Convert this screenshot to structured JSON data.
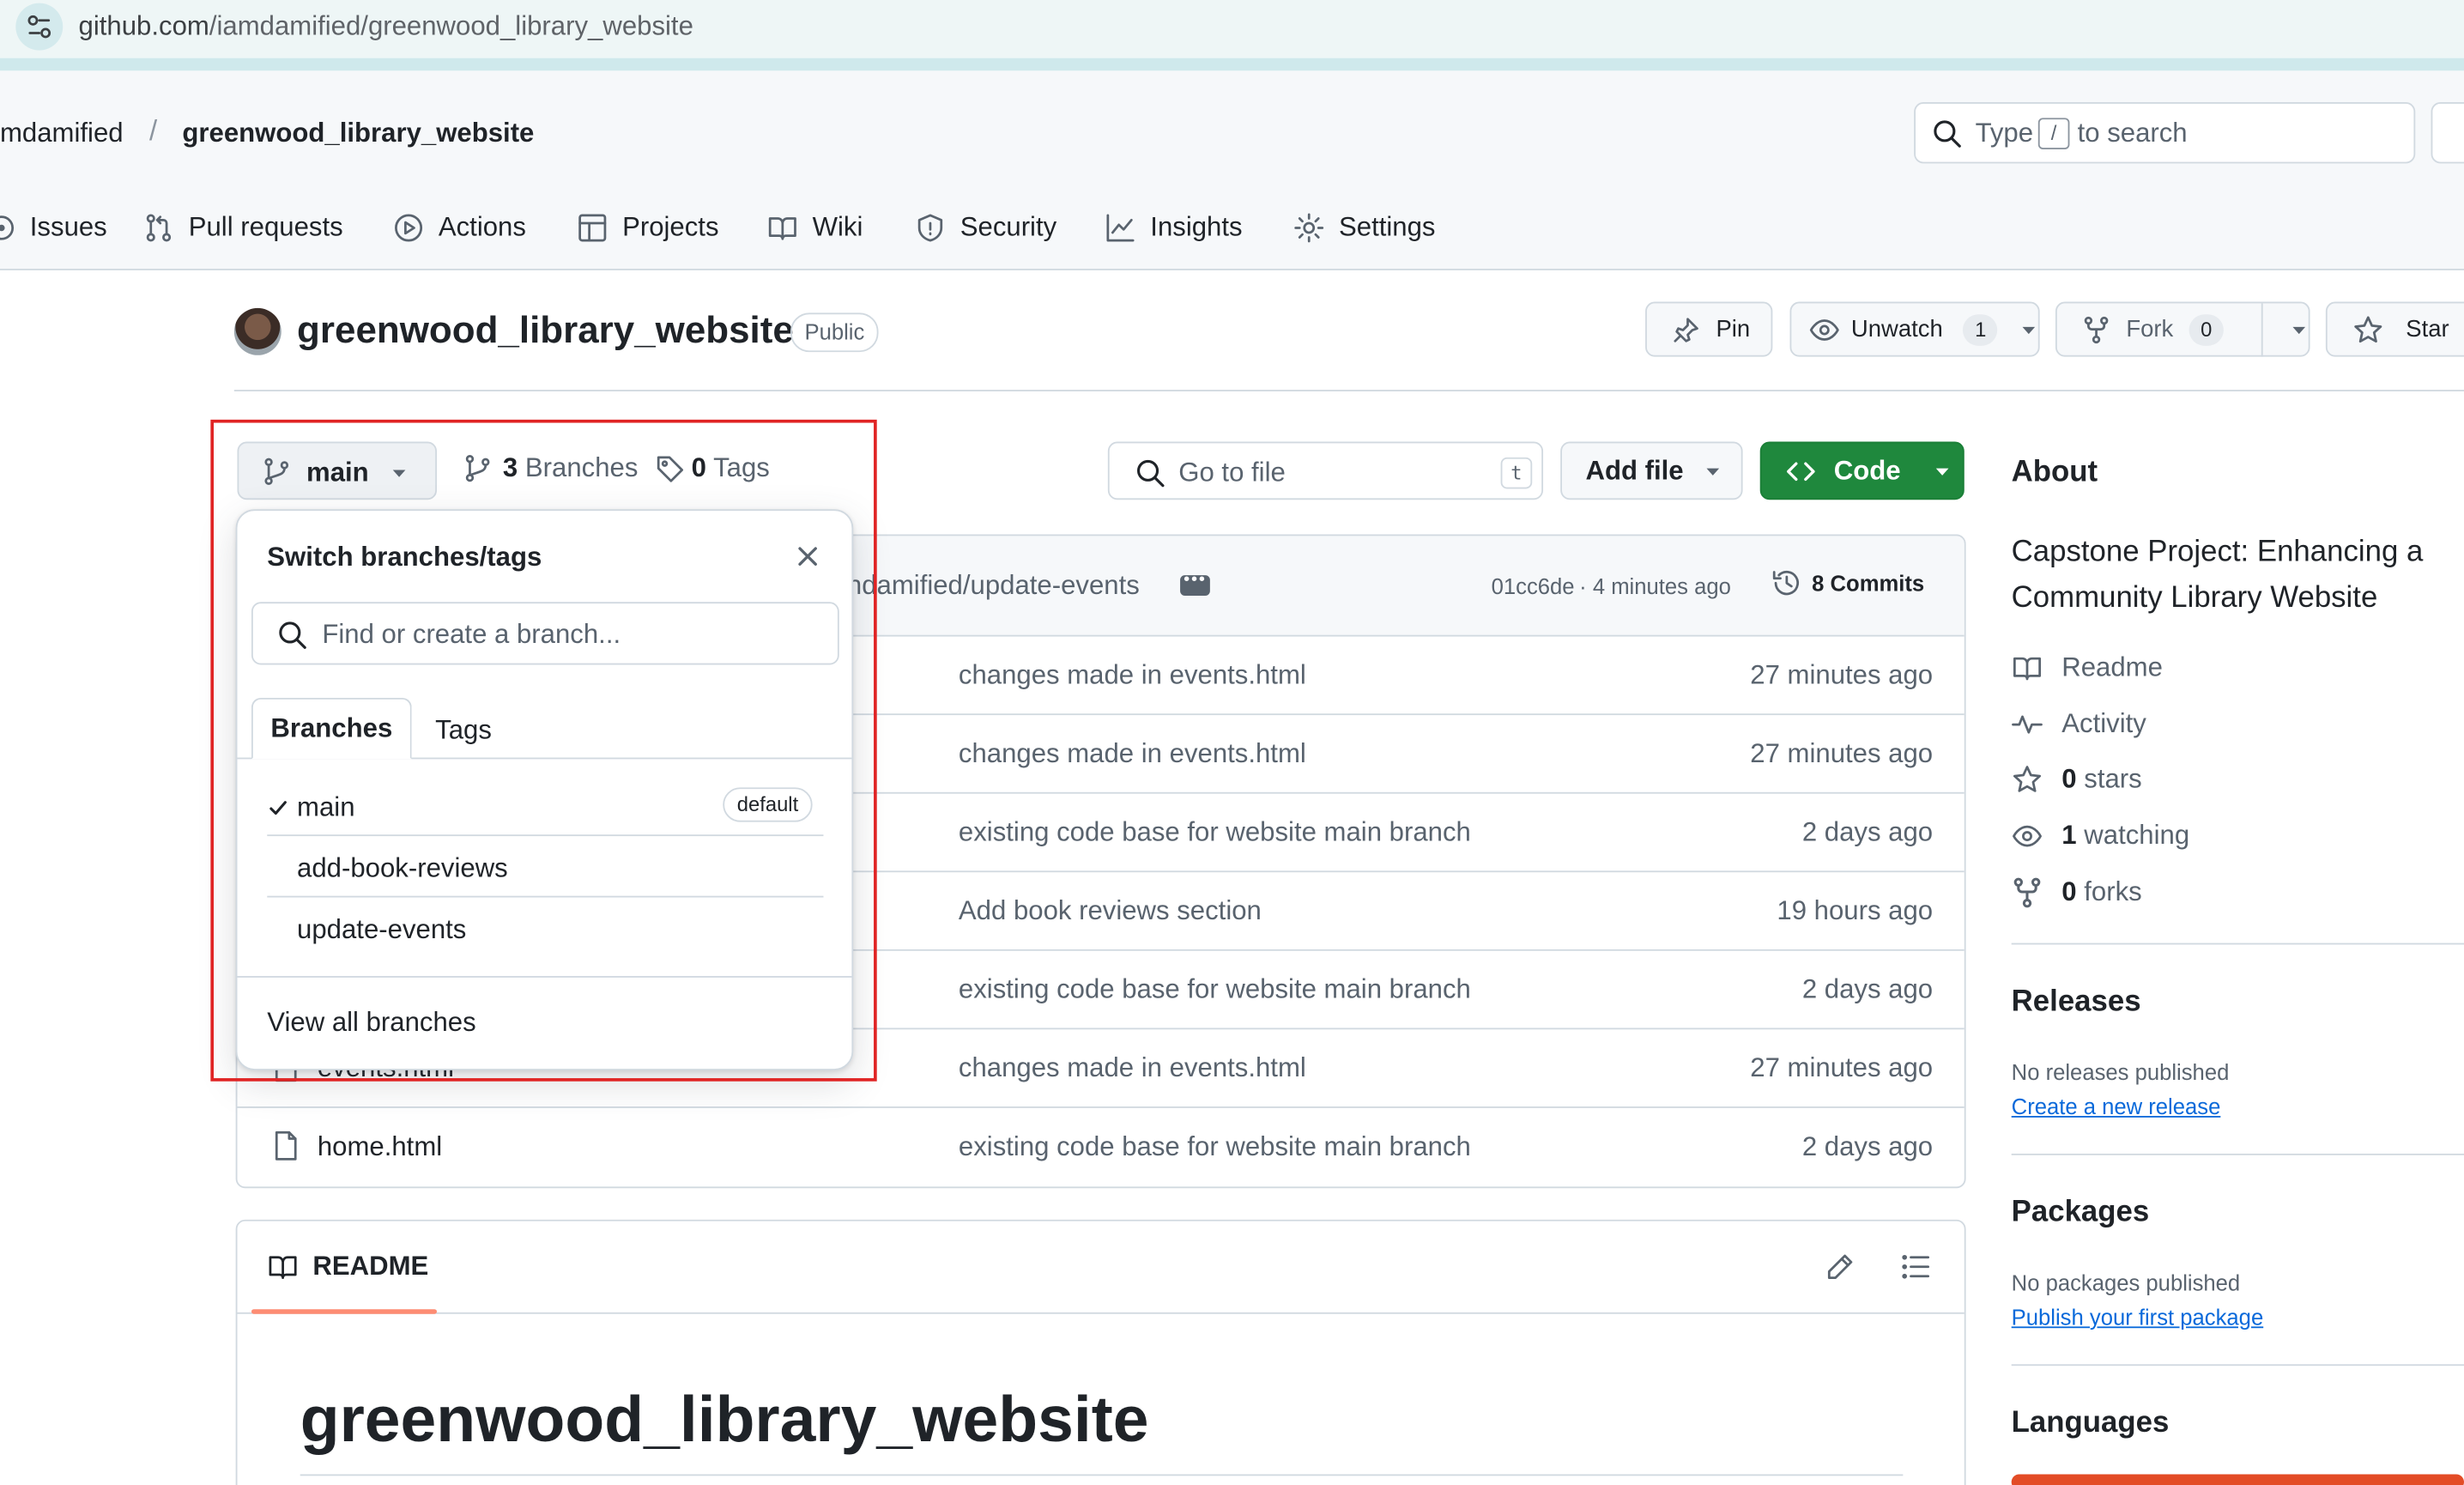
{
  "browser": {
    "url_host": "github.com",
    "url_path": "/iamdamified/greenwood_library_website"
  },
  "header": {
    "owner": "mdamified",
    "separator": "/",
    "repo": "greenwood_library_website",
    "search": {
      "prefix": "Type",
      "key": "/",
      "suffix": "to search"
    }
  },
  "nav": {
    "tabs": [
      {
        "label": "Issues",
        "icon": "issue-icon"
      },
      {
        "label": "Pull requests",
        "icon": "pull-request-icon"
      },
      {
        "label": "Actions",
        "icon": "play-icon"
      },
      {
        "label": "Projects",
        "icon": "table-icon"
      },
      {
        "label": "Wiki",
        "icon": "book-icon"
      },
      {
        "label": "Security",
        "icon": "shield-icon"
      },
      {
        "label": "Insights",
        "icon": "graph-icon"
      },
      {
        "label": "Settings",
        "icon": "gear-icon"
      }
    ]
  },
  "repo": {
    "title": "greenwood_library_website",
    "visibility": "Public",
    "pin": "Pin",
    "unwatch": "Unwatch",
    "watch_count": "1",
    "fork": "Fork",
    "fork_count": "0",
    "star": "Star"
  },
  "toolbar": {
    "branch": "main",
    "branches_count": "3",
    "branches_label": "Branches",
    "tags_count": "0",
    "tags_label": "Tags",
    "goto_placeholder": "Go to file",
    "goto_key": "t",
    "add_file": "Add file",
    "code": "Code"
  },
  "commit_bar": {
    "message": "ndamified/update-events",
    "hash": "01cc6de",
    "time": "· 4 minutes ago",
    "commits": "8 Commits"
  },
  "files": [
    {
      "name": "",
      "message": "changes made in events.html",
      "age": "27 minutes ago"
    },
    {
      "name": "",
      "message": "changes made in events.html",
      "age": "27 minutes ago"
    },
    {
      "name": "",
      "message": "existing code base for website main branch",
      "age": "2 days ago"
    },
    {
      "name": "",
      "message": "Add book reviews section",
      "age": "19 hours ago"
    },
    {
      "name": "",
      "message": "existing code base for website main branch",
      "age": "2 days ago"
    },
    {
      "name": "events.html",
      "message": "changes made in events.html",
      "age": "27 minutes ago"
    },
    {
      "name": "home.html",
      "message": "existing code base for website main branch",
      "age": "2 days ago"
    }
  ],
  "dropdown": {
    "title": "Switch branches/tags",
    "search_placeholder": "Find or create a branch...",
    "tab_branches": "Branches",
    "tab_tags": "Tags",
    "branches": [
      {
        "name": "main",
        "selected": true,
        "badge": "default"
      },
      {
        "name": "add-book-reviews",
        "selected": false,
        "badge": ""
      },
      {
        "name": "update-events",
        "selected": false,
        "badge": ""
      }
    ],
    "view_all": "View all branches"
  },
  "readme": {
    "tab": "README",
    "heading": "greenwood_library_website"
  },
  "sidebar": {
    "about_title": "About",
    "description": "Capstone Project: Enhancing a Community Library Website",
    "readme": "Readme",
    "activity": "Activity",
    "stars_count": "0",
    "stars_label": "stars",
    "watching_count": "1",
    "watching_label": "watching",
    "forks_count": "0",
    "forks_label": "forks",
    "releases_title": "Releases",
    "releases_none": "No releases published",
    "releases_link": "Create a new release",
    "packages_title": "Packages",
    "packages_none": "No packages published",
    "packages_link": "Publish your first package",
    "languages_title": "Languages"
  },
  "colors": {
    "accent_green": "#1f883d",
    "highlight_red": "#e02424",
    "link_blue": "#0969da",
    "underline_orange": "#fd8c73",
    "language_bar": "#e34c26"
  }
}
